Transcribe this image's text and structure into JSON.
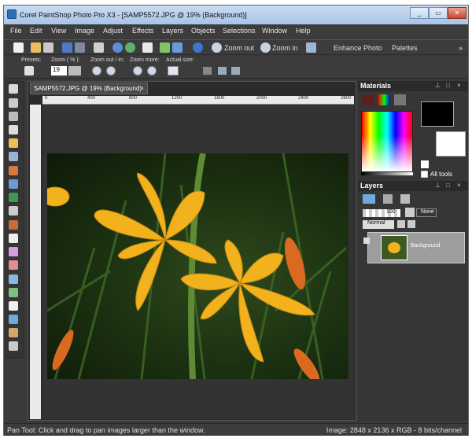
{
  "window": {
    "title": "Corel PaintShop Photo Pro X3 - [SAMP5572.JPG @  19% (Background)]",
    "minimize": "_",
    "maximize": "▭",
    "close": "✕"
  },
  "menu": [
    "File",
    "Edit",
    "View",
    "Image",
    "Adjust",
    "Effects",
    "Layers",
    "Objects",
    "Selections",
    "Window",
    "Help"
  ],
  "toolbar": {
    "zoom_out": "Zoom out",
    "zoom_in": "Zoom in",
    "enhance_photo": "Enhance Photo",
    "palettes": "Palettes",
    "overflow": "»"
  },
  "tooloptions": {
    "presets_label": "Presets:",
    "zoom_label": "Zoom ( % ):",
    "zoom_value": "19",
    "zoom_out_in_label": "Zoom out / in:",
    "zoom_more_label": "Zoom more:",
    "actual_size_label": "Actual size:"
  },
  "document": {
    "tab": "SAMP5572.JPG @  19% (Background)",
    "ruler_ticks": [
      "0",
      "400",
      "800",
      "1200",
      "1600",
      "2000",
      "2400",
      "2800"
    ]
  },
  "materials": {
    "title": "Materials",
    "all_tools": "All tools"
  },
  "layers": {
    "title": "Layers",
    "opacity": "100",
    "blend_mode": "Normal",
    "blend_none": "None",
    "layer_name": "Background"
  },
  "status": {
    "left": "Pan Tool: Click and drag to pan images larger than the window.",
    "right": "Image:  2848 x 2136 x RGB - 8 bits/channel"
  },
  "colors": {
    "accent": "#2d6fb7",
    "photo_flower": "#f2b21d",
    "photo_leaf": "#3f6a26"
  }
}
